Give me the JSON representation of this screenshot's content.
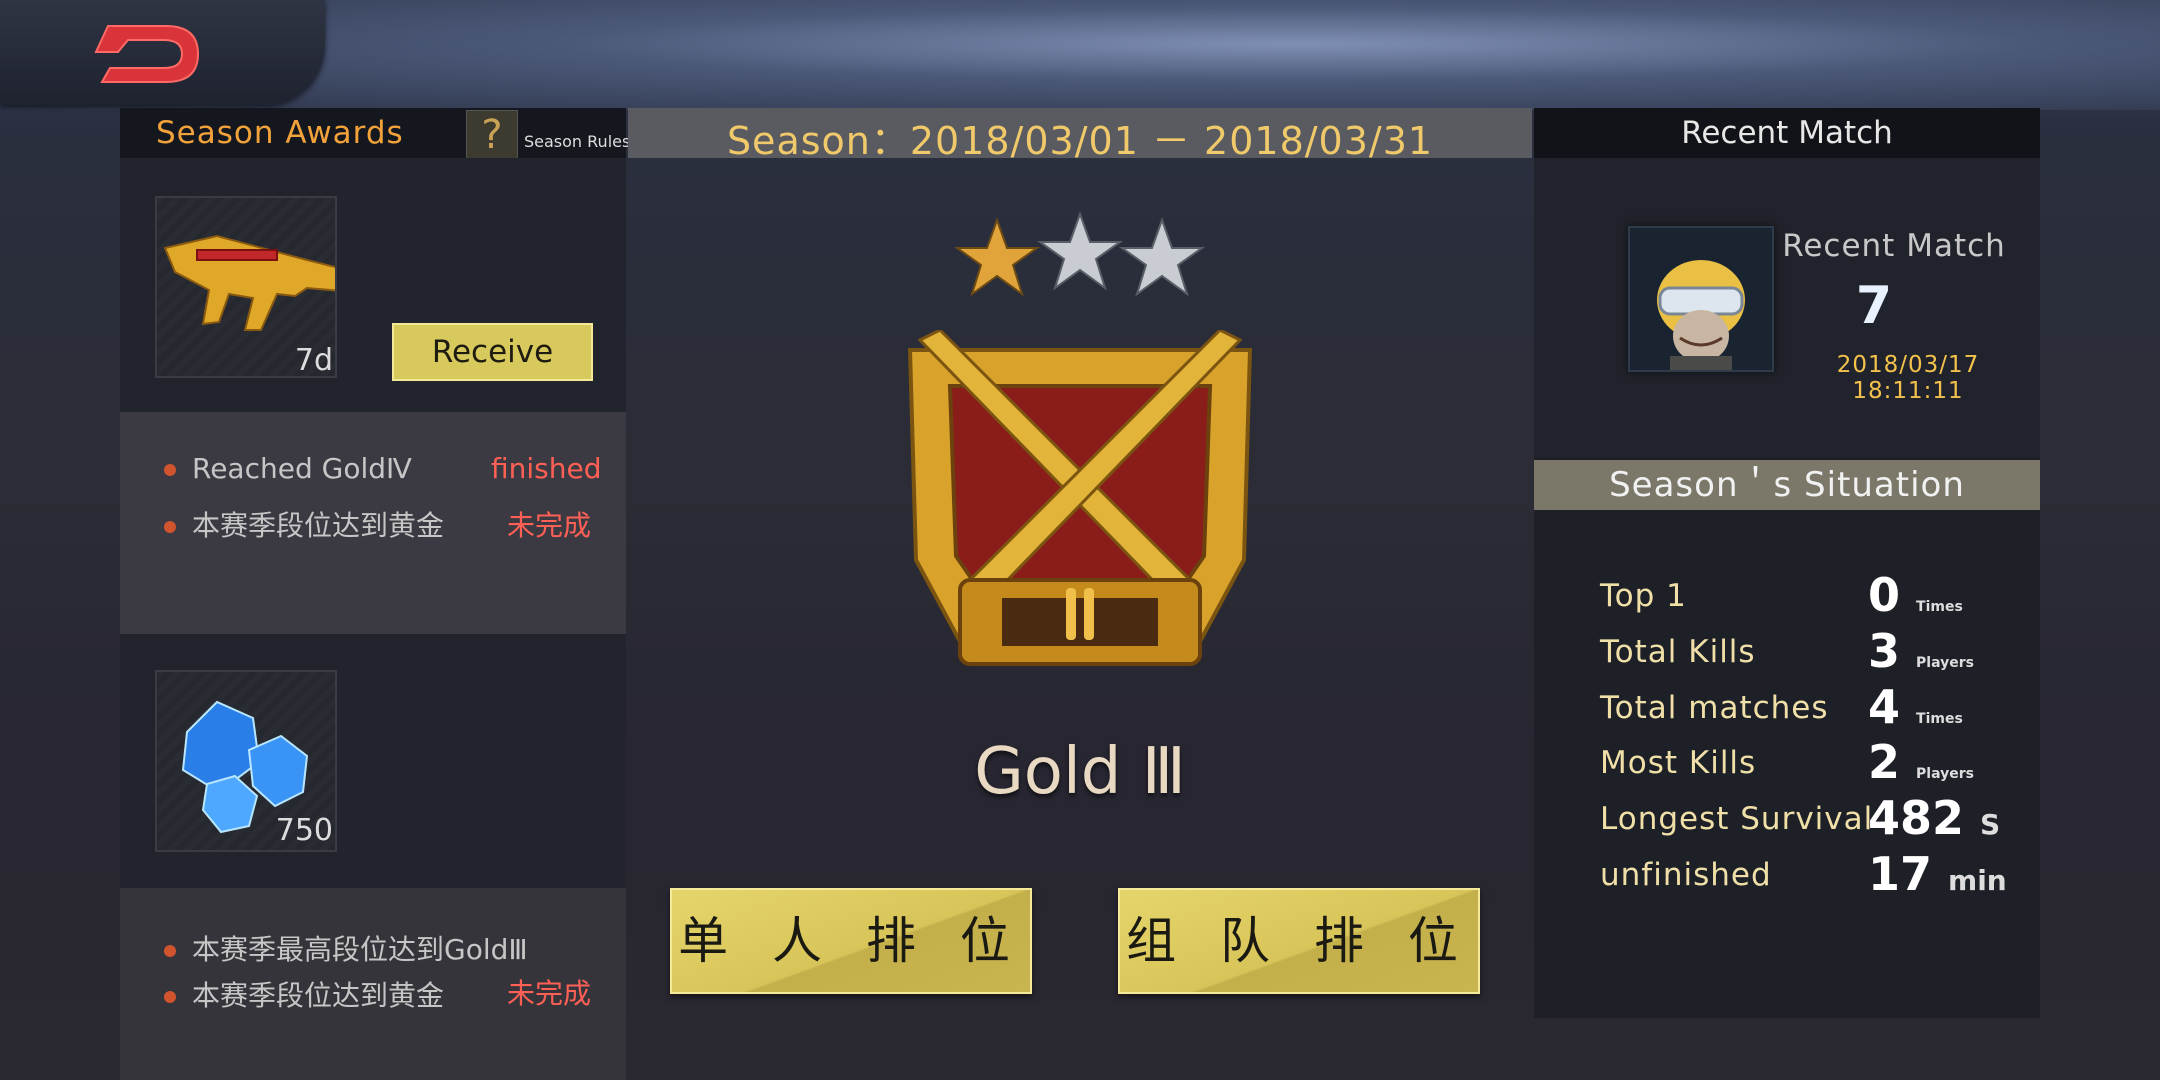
{
  "back": {
    "label": "back"
  },
  "season_awards": {
    "title": "Season  Awards",
    "rules_icon": "?",
    "rules_label": "Season  Rules",
    "reward1": {
      "icon": "golden-rifle",
      "qty": "7d",
      "button": "Receive"
    },
    "requirements1": [
      {
        "text": "Reached  GoldⅣ",
        "status": "finished"
      },
      {
        "text": "本赛季段位达到黄金",
        "status": "未完成"
      }
    ],
    "reward2": {
      "icon": "blue-diamonds",
      "qty": "750"
    },
    "requirements2": [
      {
        "text": "本赛季最高段位达到GoldⅢ",
        "status": ""
      },
      {
        "text": "本赛季段位达到黄金",
        "status": "未完成"
      }
    ]
  },
  "season": {
    "title": "Season：2018/03/01  －  2018/03/31",
    "stars_filled": 1,
    "stars_total": 3,
    "rank_name": "Gold Ⅲ",
    "solo_button": "单 人 排 位",
    "team_button": "组 队 排 位"
  },
  "recent_match": {
    "header": "Recent Match",
    "title": "Recent  Match",
    "rank": "7",
    "time": "2018/03/17  18:11:11"
  },
  "situation": {
    "header": "Season＇s  Situation",
    "stats": [
      {
        "label": "Top  1",
        "value": "0",
        "unit": "Times"
      },
      {
        "label": "Total  Kills",
        "value": "3",
        "unit": "Players"
      },
      {
        "label": "Total  matches",
        "value": "4",
        "unit": "Times"
      },
      {
        "label": "Most  Kills",
        "value": "2",
        "unit": "Players"
      },
      {
        "label": "Longest  Survival",
        "value": "482",
        "unit": "S"
      },
      {
        "label": "unfinished",
        "value": "17",
        "unit": "min"
      }
    ]
  },
  "colors": {
    "accent_gold": "#d8c95c",
    "award_title": "#f2a23a",
    "status_red": "#ff6055"
  }
}
